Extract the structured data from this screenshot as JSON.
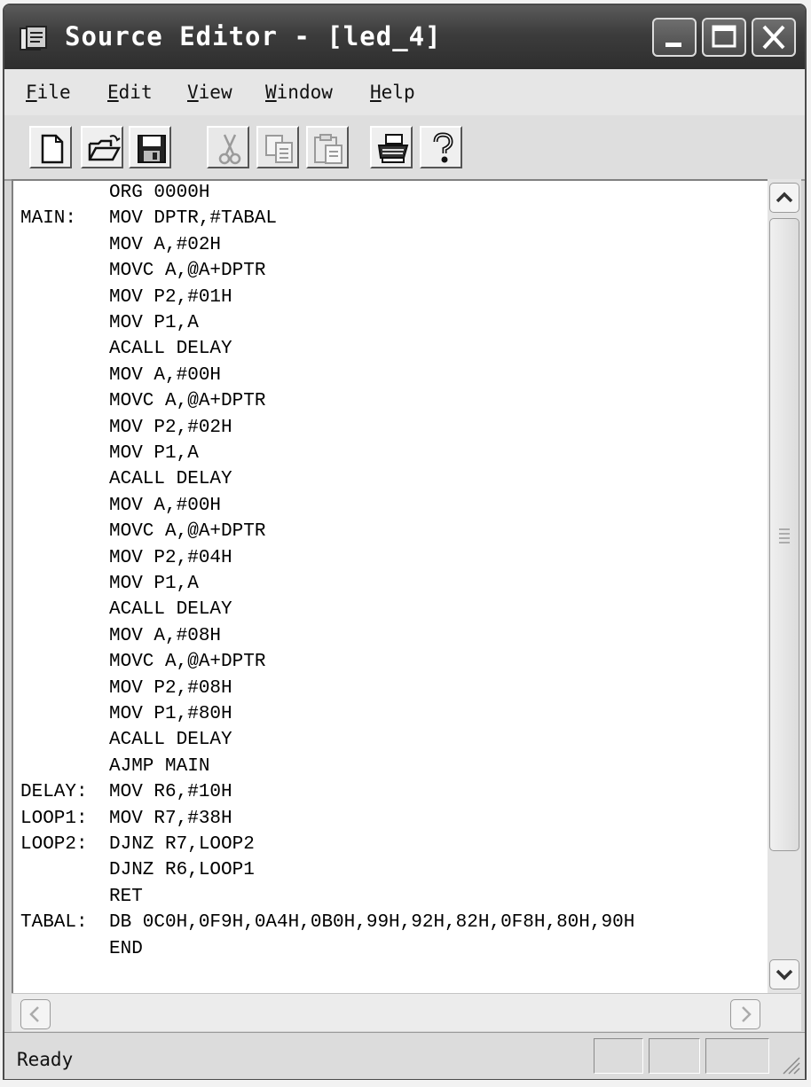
{
  "window": {
    "title": "Source Editor - [led_4]",
    "controls": {
      "minimize_icon": "minimize-icon",
      "maximize_icon": "maximize-icon",
      "close_icon": "close-icon"
    }
  },
  "menu": [
    {
      "key": "F",
      "rest": "ile"
    },
    {
      "key": "E",
      "rest": "dit"
    },
    {
      "key": "V",
      "rest": "iew"
    },
    {
      "key": "W",
      "rest": "indow"
    },
    {
      "key": "H",
      "rest": "elp"
    }
  ],
  "toolbar": [
    {
      "icon": "new-file-icon",
      "enabled": true
    },
    {
      "icon": "open-folder-icon",
      "enabled": true
    },
    {
      "icon": "save-icon",
      "enabled": true
    },
    {
      "icon": "cut-icon",
      "enabled": false
    },
    {
      "icon": "copy-icon",
      "enabled": false
    },
    {
      "icon": "paste-icon",
      "enabled": false
    },
    {
      "icon": "print-icon",
      "enabled": true
    },
    {
      "icon": "help-icon",
      "enabled": true
    }
  ],
  "code": [
    {
      "label": "",
      "instr": "ORG 0000H"
    },
    {
      "label": "MAIN:",
      "instr": "MOV DPTR,#TABAL"
    },
    {
      "label": "",
      "instr": "MOV A,#02H"
    },
    {
      "label": "",
      "instr": "MOVC A,@A+DPTR"
    },
    {
      "label": "",
      "instr": "MOV P2,#01H"
    },
    {
      "label": "",
      "instr": "MOV P1,A"
    },
    {
      "label": "",
      "instr": "ACALL DELAY"
    },
    {
      "label": "",
      "instr": "MOV A,#00H"
    },
    {
      "label": "",
      "instr": "MOVC A,@A+DPTR"
    },
    {
      "label": "",
      "instr": "MOV P2,#02H"
    },
    {
      "label": "",
      "instr": "MOV P1,A"
    },
    {
      "label": "",
      "instr": "ACALL DELAY"
    },
    {
      "label": "",
      "instr": "MOV A,#00H"
    },
    {
      "label": "",
      "instr": "MOVC A,@A+DPTR"
    },
    {
      "label": "",
      "instr": "MOV P2,#04H"
    },
    {
      "label": "",
      "instr": "MOV P1,A"
    },
    {
      "label": "",
      "instr": "ACALL DELAY"
    },
    {
      "label": "",
      "instr": "MOV A,#08H"
    },
    {
      "label": "",
      "instr": "MOVC A,@A+DPTR"
    },
    {
      "label": "",
      "instr": "MOV P2,#08H"
    },
    {
      "label": "",
      "instr": "MOV P1,#80H"
    },
    {
      "label": "",
      "instr": "ACALL DELAY"
    },
    {
      "label": "",
      "instr": "AJMP MAIN"
    },
    {
      "label": "DELAY:",
      "instr": "MOV R6,#10H"
    },
    {
      "label": "LOOP1:",
      "instr": "MOV R7,#38H"
    },
    {
      "label": "LOOP2:",
      "instr": "DJNZ R7,LOOP2"
    },
    {
      "label": "",
      "instr": "DJNZ R6,LOOP1"
    },
    {
      "label": "",
      "instr": "RET"
    },
    {
      "label": "TABAL:",
      "instr": "DB 0C0H,0F9H,0A4H,0B0H,99H,92H,82H,0F8H,80H,90H"
    },
    {
      "label": "",
      "instr": "END"
    }
  ],
  "status": {
    "text": "Ready"
  },
  "colors": {
    "titlebar": "#3c3c3c",
    "chrome": "#d4d4d4",
    "editor_bg": "#ffffff"
  }
}
